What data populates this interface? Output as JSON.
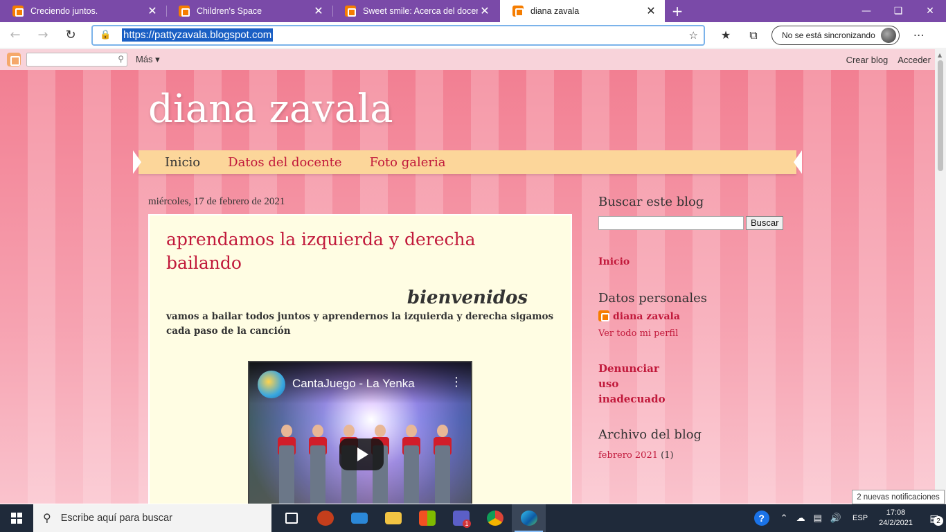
{
  "browser": {
    "tabs": [
      {
        "title": "Creciendo juntos.",
        "active": false
      },
      {
        "title": "Children's Space",
        "active": false
      },
      {
        "title": "Sweet smile: Acerca del docente",
        "active": false
      },
      {
        "title": "diana zavala",
        "active": true
      }
    ],
    "url": "https://pattyzavala.blogspot.com",
    "sync_label": "No se está sincronizando",
    "close_glyph": "✕",
    "new_tab_glyph": "+"
  },
  "blogger_nav": {
    "more_label": "Más ▾",
    "create_label": "Crear blog",
    "login_label": "Acceder"
  },
  "blog": {
    "title": "diana zavala",
    "menu": [
      "Inicio",
      "Datos del docente",
      "Foto galeria"
    ],
    "post": {
      "date": "miércoles, 17 de febrero de 2021",
      "title": "aprendamos la izquierda y derecha bailando",
      "welcome": "bienvenidos",
      "body": "vamos a bailar todos juntos y aprendernos la izquierda y derecha sigamos cada paso de la canción",
      "video_title": "CantaJuego - La Yenka"
    },
    "sidebar": {
      "search_heading": "Buscar este blog",
      "search_button": "Buscar",
      "home_link": "Inicio",
      "profile_heading": "Datos personales",
      "profile_name": "diana zavala",
      "profile_link": "Ver todo mi perfil",
      "report_line1": "Denunciar",
      "report_line2": "uso",
      "report_line3": "inadecuado",
      "archive_heading": "Archivo del blog",
      "archive_item": "febrero 2021",
      "archive_count": "(1)"
    }
  },
  "notification_toast": "2 nuevas notificaciones",
  "taskbar": {
    "search_placeholder": "Escribe aquí para buscar",
    "lang": "ESP",
    "time": "17:08",
    "date": "24/2/2021",
    "notif_count": "2",
    "teams_badge": "1"
  },
  "colors": {
    "accent_red": "#c1193b",
    "menu_bg": "#fcd69a",
    "post_bg": "#fffde3",
    "tab_strip": "#7a4aa8"
  }
}
